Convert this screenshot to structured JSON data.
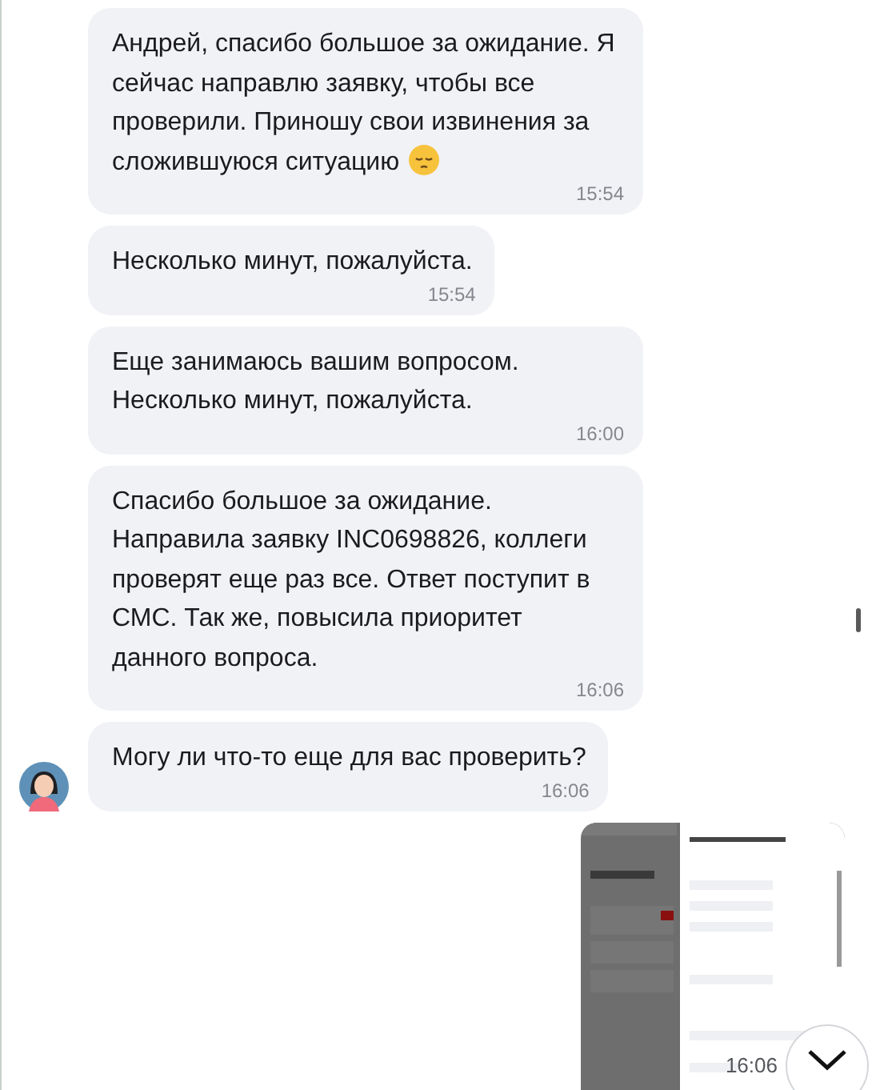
{
  "messages": [
    {
      "kind": "text",
      "text": "Андрей, спасибо большое за ожидание. Я сейчас направлю заявку, чтобы все проверили. Приношу свои извинения за сложившуюся ситуацию",
      "emoji": true,
      "time": "15:54",
      "avatar": false
    },
    {
      "kind": "text",
      "text": "Несколько минут, пожалуйста.",
      "time": "15:54",
      "avatar": false
    },
    {
      "kind": "text",
      "text": "Еще занимаюсь вашим вопросом. Несколько минут, пожалуйста.",
      "time": "16:00",
      "avatar": false
    },
    {
      "kind": "text",
      "text": "Спасибо большое за ожидание. Направила заявку INC0698826, коллеги проверят еще раз все. Ответ поступит в СМС. Так же, повысила приоритет данного вопроса.",
      "time": "16:06",
      "avatar": false
    },
    {
      "kind": "text",
      "text": "Могу ли что-то еще для вас проверить?",
      "time": "16:06",
      "avatar": true
    },
    {
      "kind": "picture",
      "time": "16:06"
    }
  ]
}
